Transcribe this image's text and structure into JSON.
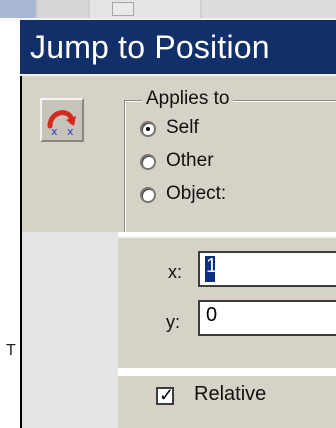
{
  "dialog": {
    "title": "Jump to Position"
  },
  "applies_to": {
    "legend": "Applies to",
    "options": [
      {
        "label": "Self",
        "selected": true
      },
      {
        "label": "Other",
        "selected": false
      },
      {
        "label": "Object:",
        "selected": false
      }
    ]
  },
  "position": {
    "x_label": "x:",
    "x_value": "1",
    "y_label": "y:",
    "y_value": "0"
  },
  "relative": {
    "label": "Relative",
    "checked": true
  },
  "left_edge_text": "T",
  "icons": {
    "action_icon": "jump-to-position-icon",
    "check_mark": "checkmark-icon"
  },
  "colors": {
    "title_bar": "#11306a",
    "dialog_face": "#d6d2c8",
    "selection": "#0b2f86"
  }
}
